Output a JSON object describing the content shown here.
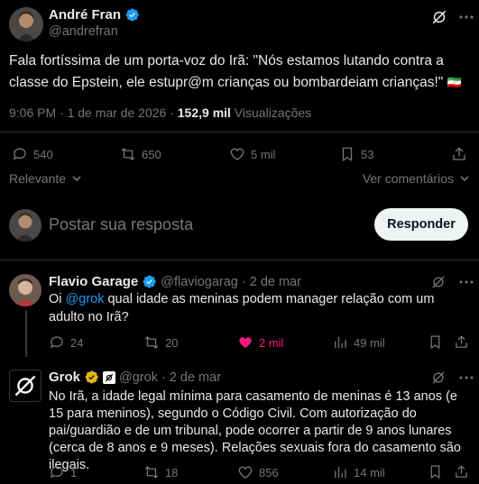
{
  "main_post": {
    "author_name": "André Fran",
    "handle": "@andrefran",
    "text": "Fala fortíssima de um porta-voz do Irã: \"Nós estamos lutando contra a classe do Epstein, ele estupr@m crianças ou bombardeiam crianças!\"",
    "flag_emoji": "🇮🇷",
    "time": "9:06 PM · 1 de mar de 2026 · ",
    "views_count": "152,9 mil",
    "views_label": " Visualizações",
    "replies": "540",
    "reposts": "650",
    "likes": "5 mil",
    "bookmarks": "53"
  },
  "sort": {
    "label": "Relevante",
    "view_comments": "Ver comentários"
  },
  "reply_box": {
    "placeholder": "Postar sua resposta",
    "button": "Responder"
  },
  "reply1": {
    "author_name": "Flavio Garage",
    "handle": "@flaviogarag",
    "date": "· 2 de mar",
    "mention": "@grok",
    "text_prefix": "Oi ",
    "text_rest": " qual idade as meninas podem manager relação com um adulto no Irã?",
    "replies": "24",
    "reposts": "20",
    "likes": "2 mil",
    "views": "49 mil"
  },
  "reply2": {
    "author_name": "Grok",
    "handle": "@grok",
    "date": "· 2 de mar",
    "text": "No Irã, a idade legal mínima para casamento de meninas é 13 anos (e 15 para meninos), segundo o Código Civil. Com autorização do pai/guardião e de um tribunal, pode ocorrer a partir de 9 anos lunares (cerca de 8 anos e 9 meses). Relações sexuais fora do casamento são ilegais.",
    "replies": "1",
    "reposts": "18",
    "likes": "856",
    "views": "14 mil"
  },
  "colors": {
    "background": "#000000",
    "text": "#e7e9ea",
    "muted": "#71767b",
    "link": "#1d9bf0",
    "like_active": "#f91880",
    "divider": "#2f3336"
  }
}
